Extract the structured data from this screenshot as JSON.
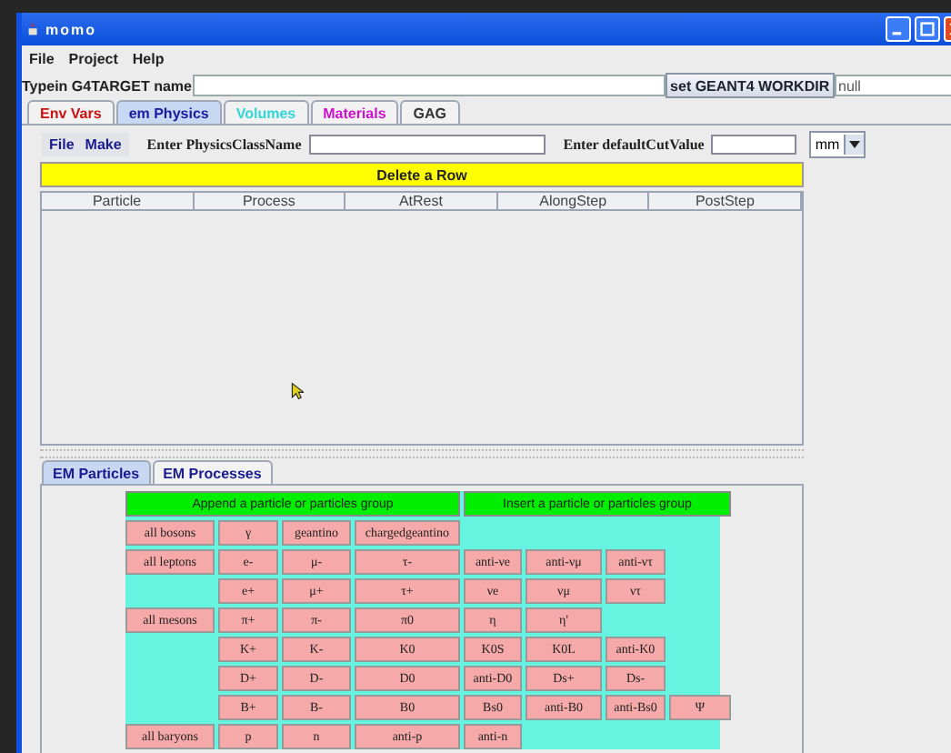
{
  "window": {
    "title": "momo"
  },
  "menu": [
    "File",
    "Project",
    "Help"
  ],
  "target": {
    "label": "Typein G4TARGET name",
    "button": "set GEANT4 WORKDIR",
    "workdir": "null"
  },
  "tabs": [
    {
      "label": "Env Vars",
      "color": "#cc1111",
      "selected": false
    },
    {
      "label": "em Physics",
      "color": "#1a1aa0",
      "selected": true
    },
    {
      "label": "Volumes",
      "color": "#33d6d6",
      "selected": false
    },
    {
      "label": "Materials",
      "color": "#cc11cc",
      "selected": false
    },
    {
      "label": "GAG",
      "color": "#333333",
      "selected": false
    }
  ],
  "physics": {
    "menu": [
      "File",
      "Make"
    ],
    "class_name_label": "Enter PhysicsClassName",
    "cut_label": "Enter defaultCutValue",
    "unit": "mm",
    "delete_button": "Delete a Row",
    "columns": [
      "Particle",
      "Process",
      "AtRest",
      "AlongStep",
      "PostStep"
    ]
  },
  "subtabs": [
    {
      "label": "EM Particles",
      "selected": true
    },
    {
      "label": "EM Processes",
      "selected": false
    }
  ],
  "particles": {
    "buttons": [
      "Append a particle or particles group",
      "Insert a particle or particles group"
    ],
    "rows": [
      {
        "group": "all bosons",
        "items": [
          "γ",
          "geantino",
          "chargedgeantino"
        ]
      },
      {
        "group": "all leptons",
        "items": [
          "e-",
          "μ-",
          "τ-",
          "anti-νe",
          "anti-νμ",
          "anti-ντ"
        ]
      },
      {
        "items": [
          "e+",
          "μ+",
          "τ+",
          "νe",
          "νμ",
          "ντ"
        ]
      },
      {
        "group": "all mesons",
        "items": [
          "π+",
          "π-",
          "π0",
          "η",
          "η'"
        ]
      },
      {
        "items": [
          "K+",
          "K-",
          "K0",
          "K0S",
          "K0L",
          "anti-K0"
        ]
      },
      {
        "items": [
          "D+",
          "D-",
          "D0",
          "anti-D0",
          "Ds+",
          "Ds-"
        ]
      },
      {
        "items": [
          "B+",
          "B-",
          "B0",
          "Bs0",
          "anti-B0",
          "anti-Bs0",
          "Ψ"
        ]
      },
      {
        "group": "all baryons",
        "items": [
          "p",
          "n",
          "anti-p",
          "anti-n"
        ]
      }
    ]
  }
}
